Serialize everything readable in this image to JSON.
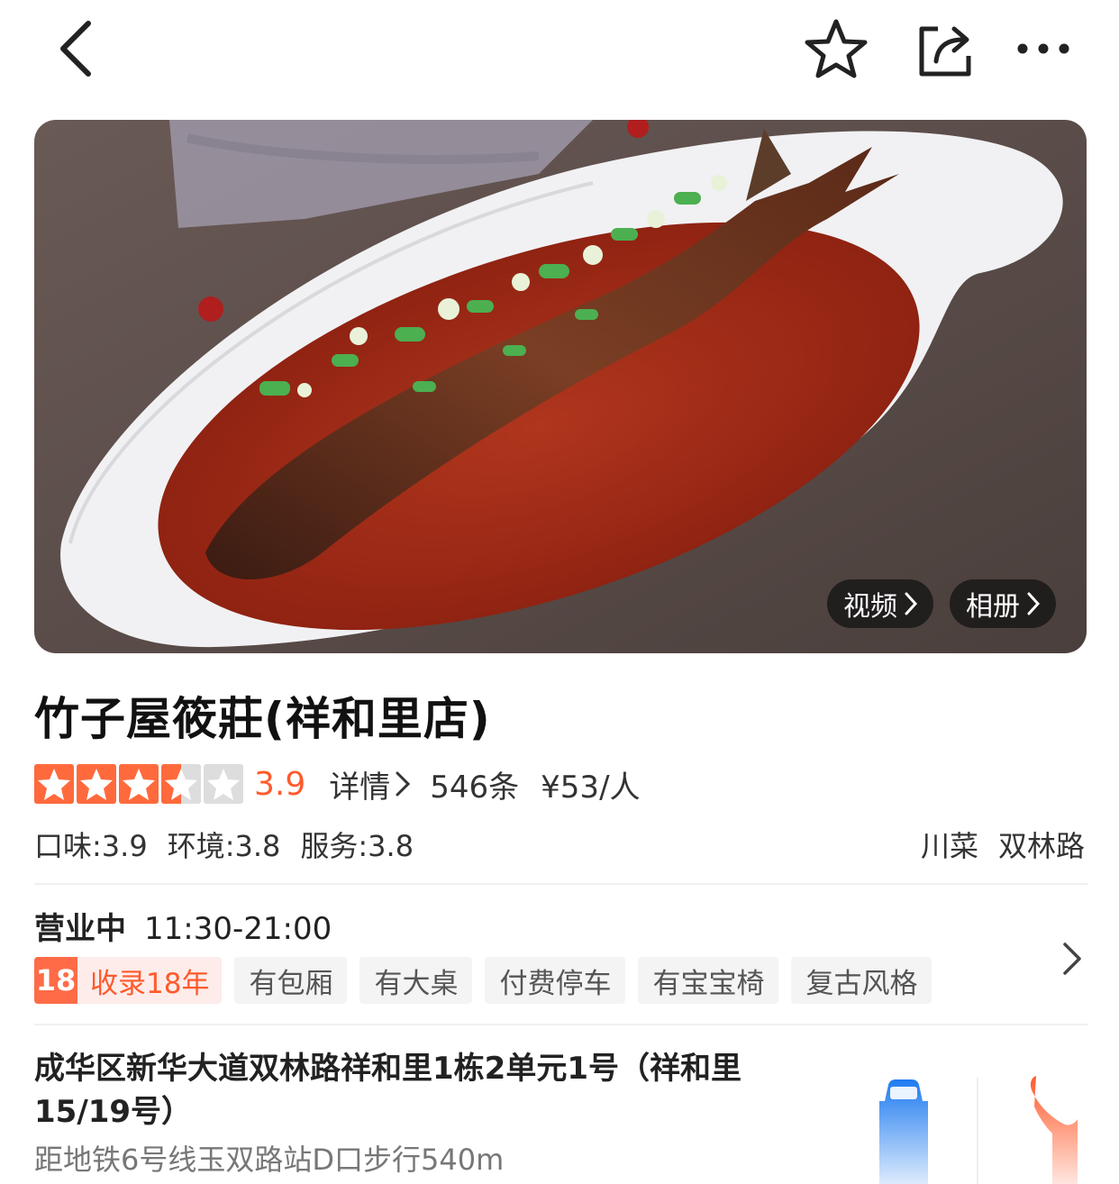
{
  "nav": {
    "back_icon": "chevron-left-icon",
    "favorite_icon": "star-outline-icon",
    "share_icon": "share-icon",
    "more_icon": "more-dots-icon"
  },
  "hero": {
    "video_label": "视频",
    "album_label": "相册"
  },
  "shop": {
    "name": "竹子屋筱莊(祥和里店)",
    "rating_stars": 3.5,
    "rating_score": "3.9",
    "detail_label": "详情",
    "review_count": "546条",
    "price_per_person": "¥53/人",
    "sub_scores": [
      {
        "label": "口味:3.9"
      },
      {
        "label": "环境:3.8"
      },
      {
        "label": "服务:3.8"
      }
    ],
    "cuisine": "川菜",
    "area": "双林路"
  },
  "hours": {
    "status": "营业中",
    "time": "11:30-21:00"
  },
  "tags": {
    "years_badge": "18",
    "years_text": "收录18年",
    "items": [
      "有包厢",
      "有大桌",
      "付费停车",
      "有宝宝椅",
      "复古风格"
    ]
  },
  "location": {
    "address": "成华区新华大道双林路祥和里1栋2单元1号（祥和里15/19号）",
    "metro": "距地铁6号线玉双路站D口步行540m"
  },
  "colors": {
    "accent": "#ff5a2c",
    "star_fill": "#ff6a3d",
    "route_blue": "#1f7bf0",
    "phone_orange": "#ff5a2c"
  }
}
